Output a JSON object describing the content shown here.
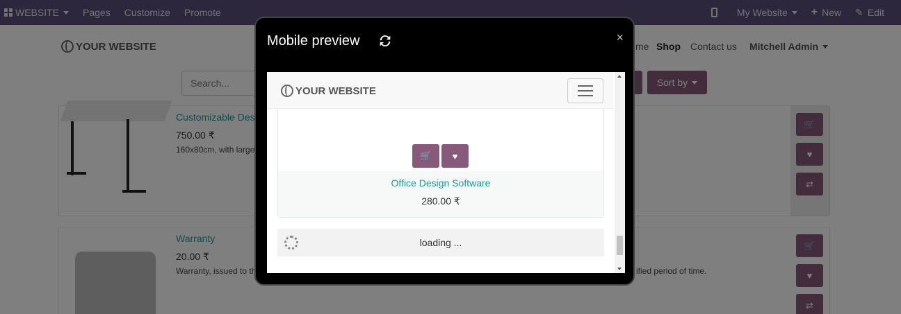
{
  "topbar": {
    "website": "WEBSITE",
    "pages": "Pages",
    "customize": "Customize",
    "promote": "Promote",
    "my_website": "My Website",
    "new": "New",
    "edit": "Edit"
  },
  "site": {
    "logo_text": "YOUR WEBSITE",
    "nav": [
      "me",
      "Shop",
      "Contact us",
      "Mitchell Admin"
    ],
    "search_placeholder": "Search...",
    "sort_by": "Sort by"
  },
  "products": [
    {
      "title": "Customizable Des",
      "price": "750.00 ₹",
      "desc": "160x80cm, with large"
    },
    {
      "title": "Warranty",
      "price": "20.00 ₹",
      "desc": "Warranty, issued to th",
      "desc_end": "ified period of time."
    }
  ],
  "modal": {
    "title": "Mobile preview",
    "close": "×",
    "card_title": "Office Design Software",
    "card_price": "280.00 ₹",
    "loading": "loading ..."
  },
  "icons": {
    "cart": "cart-icon",
    "heart": "heart-icon",
    "compare": "compare-icon",
    "refresh": "refresh-icon"
  },
  "colors": {
    "topbar": "#5a4f7c",
    "accent": "#875a7b",
    "link": "#1a9a9a"
  }
}
